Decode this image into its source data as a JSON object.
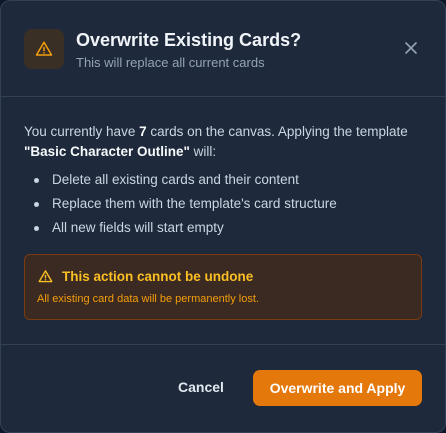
{
  "colors": {
    "dialog_bg": "#1e293b",
    "accent": "#e5780b",
    "warning_text": "#fbbf24",
    "warning_subtext": "#f59e0b"
  },
  "dialog": {
    "title": "Overwrite Existing Cards?",
    "subtitle": "This will replace all current cards",
    "icon": "warning-triangle-icon",
    "close_icon": "close-icon"
  },
  "message": {
    "part1": "You currently have ",
    "card_count": "7",
    "part2": " cards on the canvas. Applying the template ",
    "template_name": "\"Basic Character Outline\"",
    "part3": " will:"
  },
  "effects": [
    "Delete all existing cards and their content",
    "Replace them with the template's card structure",
    "All new fields will start empty"
  ],
  "alert": {
    "icon": "warning-triangle-icon",
    "title": "This action cannot be undone",
    "message": "All existing card data will be permanently lost."
  },
  "footer": {
    "cancel_label": "Cancel",
    "confirm_label": "Overwrite and Apply"
  }
}
